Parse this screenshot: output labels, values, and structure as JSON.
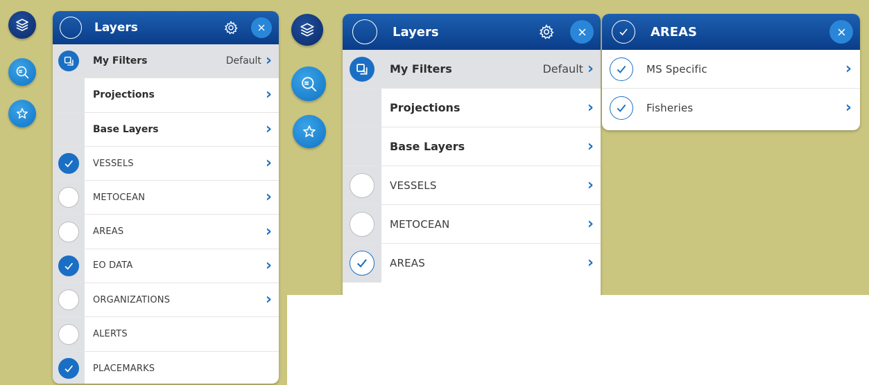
{
  "colors": {
    "background": "#cbc67f",
    "header": "#0a3d8a",
    "accent": "#1a6fc4",
    "row_shade": "#dfe1e4"
  },
  "rail": [
    {
      "name": "layers-rail-button",
      "icon": "layers-icon",
      "style": "dark"
    },
    {
      "name": "search-rail-button",
      "icon": "euro-search-icon",
      "style": "light"
    },
    {
      "name": "favorites-rail-button",
      "icon": "star-icon",
      "style": "light"
    }
  ],
  "layers_panel": {
    "title": "Layers",
    "my_filters": {
      "label": "My Filters",
      "value": "Default"
    },
    "projections": {
      "label": "Projections"
    },
    "base_layers": {
      "label": "Base Layers"
    },
    "items": [
      {
        "label": "VESSELS",
        "checked": true
      },
      {
        "label": "METOCEAN",
        "checked": false
      },
      {
        "label": "AREAS",
        "checked": false
      },
      {
        "label": "EO DATA",
        "checked": true
      },
      {
        "label": "ORGANIZATIONS",
        "checked": false,
        "chevron": true
      },
      {
        "label": "ALERTS",
        "checked": false,
        "chevron": false
      },
      {
        "label": "PLACEMARKS",
        "checked": true,
        "chevron": false
      }
    ]
  },
  "layers_panel_2": {
    "title": "Layers",
    "my_filters": {
      "label": "My Filters",
      "value": "Default"
    },
    "projections": {
      "label": "Projections"
    },
    "base_layers": {
      "label": "Base Layers"
    },
    "items": [
      {
        "label": "VESSELS",
        "checked": false
      },
      {
        "label": "METOCEAN",
        "checked": false
      },
      {
        "label": "AREAS",
        "checked": true
      }
    ]
  },
  "areas_panel": {
    "title": "AREAS",
    "items": [
      {
        "label": "MS Specific",
        "checked": true
      },
      {
        "label": "Fisheries",
        "checked": true
      }
    ]
  }
}
